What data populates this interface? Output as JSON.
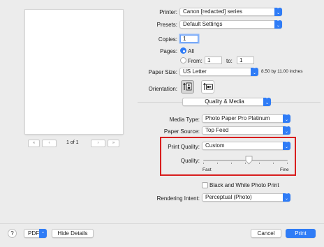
{
  "preview": {
    "page_indicator": "1 of 1",
    "first_label": "«",
    "prev_label": "‹",
    "next_label": "›",
    "last_label": "»"
  },
  "printer": {
    "label": "Printer:",
    "value": "Canon [redacted] series"
  },
  "presets": {
    "label": "Presets:",
    "value": "Default Settings"
  },
  "copies": {
    "label": "Copies:",
    "value": "1"
  },
  "pages": {
    "label": "Pages:",
    "all_label": "All",
    "from_label": "From:",
    "from_value": "1",
    "to_label": "to:",
    "to_value": "1"
  },
  "paper_size": {
    "label": "Paper Size:",
    "value": "US Letter",
    "dimensions": "8.50 by 11.00 inches"
  },
  "orientation": {
    "label": "Orientation:"
  },
  "section_popup": {
    "value": "Quality & Media"
  },
  "media_type": {
    "label": "Media Type:",
    "value": "Photo Paper Pro Platinum"
  },
  "paper_source": {
    "label": "Paper Source:",
    "value": "Top Feed"
  },
  "print_quality": {
    "label": "Print Quality:",
    "value": "Custom"
  },
  "quality": {
    "label": "Quality:",
    "min_label": "Fast",
    "max_label": "Fine",
    "level": 0.54
  },
  "bw_photo": {
    "label": "Black and White Photo Print",
    "checked": false
  },
  "rendering_intent": {
    "label": "Rendering Intent:",
    "value": "Perceptual (Photo)"
  },
  "footer": {
    "help_label": "?",
    "pdf_label": "PDF",
    "hide_details_label": "Hide Details",
    "cancel_label": "Cancel",
    "print_label": "Print"
  },
  "colors": {
    "accent": "#2f7cf6",
    "highlight": "#d81e1e"
  },
  "icons": [
    "chevron-updown-icon",
    "portrait-orientation-icon",
    "landscape-orientation-icon",
    "help-icon"
  ]
}
